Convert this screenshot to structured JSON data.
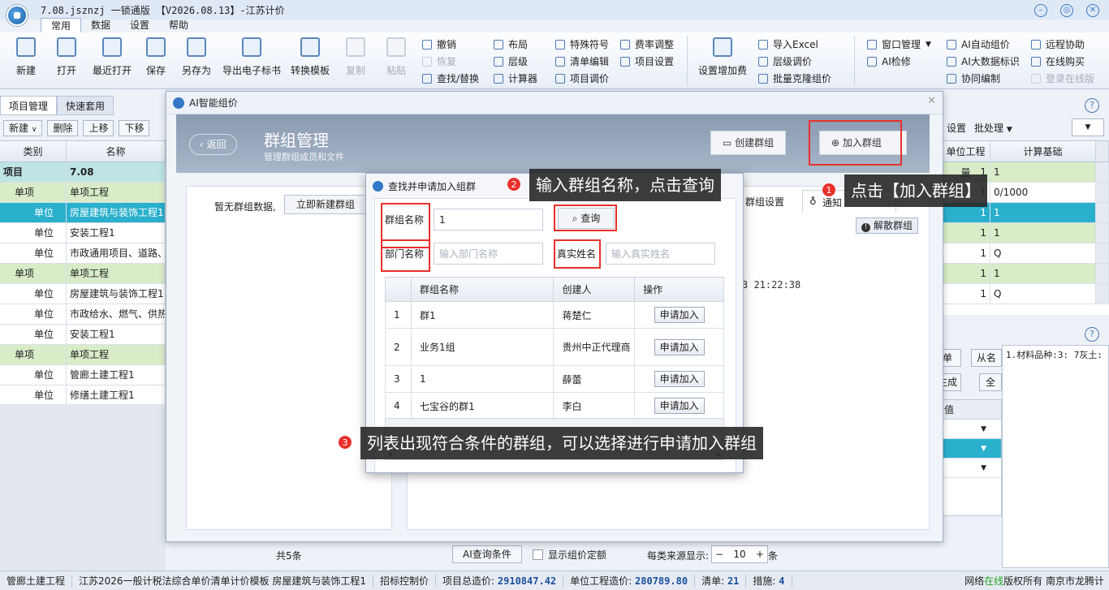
{
  "window": {
    "title": "7.08.jsznzj  一锁通版 【V2026.08.13】-江苏计价",
    "controls": [
      "minimize-icon",
      "settings-icon",
      "close-icon"
    ]
  },
  "menu_tabs": [
    "常用",
    "数据",
    "设置",
    "帮助"
  ],
  "ribbon": {
    "big": [
      "新建",
      "打开",
      "最近打开",
      "保存",
      "另存为",
      "导出电子标书",
      "转换模板",
      "复制",
      "粘贴",
      "设置增加费"
    ],
    "small": {
      "undo": "撤销",
      "redo": "恢复",
      "find": "查找/替换",
      "layout": "布局",
      "level": "层级",
      "calc": "计算器",
      "special": "特殊符号",
      "list_edit": "清单编辑",
      "proj_adjust": "项目调价",
      "rate": "费率调整",
      "proj_set": "项目设置",
      "import_excel": "导入Excel",
      "level_adjust": "层级调价",
      "batch_clone": "批量克隆组价",
      "window_mgr": "窗口管理",
      "ai_check": "AI检修",
      "ai_auto": "AI自动组价",
      "ai_mark": "AI大数据标识",
      "collab": "协同编制",
      "remote": "远程协助",
      "online_buy": "在线购买",
      "online_login": "登录在线版"
    }
  },
  "left_panel": {
    "tabs": [
      "项目管理",
      "快速套用"
    ],
    "toolbar": [
      "新建",
      "删除",
      "上移",
      "下移"
    ],
    "columns": [
      "类别",
      "名称"
    ],
    "rows": [
      {
        "type": "项目",
        "name": "7.08",
        "style": "proj"
      },
      {
        "type": "单项",
        "name": "单项工程",
        "style": "item"
      },
      {
        "type": "单位",
        "name": "房屋建筑与装饰工程1",
        "style": "sel"
      },
      {
        "type": "单位",
        "name": "安装工程1",
        "style": ""
      },
      {
        "type": "单位",
        "name": "市政通用项目、道路、",
        "style": ""
      },
      {
        "type": "单项",
        "name": "单项工程",
        "style": "item"
      },
      {
        "type": "单位",
        "name": "房屋建筑与装饰工程1",
        "style": ""
      },
      {
        "type": "单位",
        "name": "市政给水、燃气、供热",
        "style": ""
      },
      {
        "type": "单位",
        "name": "安装工程1",
        "style": ""
      },
      {
        "type": "单项",
        "name": "单项工程",
        "style": "item"
      },
      {
        "type": "单位",
        "name": "管廊土建工程1",
        "style": ""
      },
      {
        "type": "单位",
        "name": "修缮土建工程1",
        "style": ""
      }
    ]
  },
  "right_panel": {
    "toolbar": [
      "设置",
      "批处理"
    ],
    "columns": [
      "单位工程量",
      "计算基础"
    ],
    "rows": [
      {
        "qty": "1",
        "base": "1",
        "style": "g"
      },
      {
        "qty": "1",
        "base": "0/1000",
        "style": ""
      },
      {
        "qty": "1",
        "base": "1",
        "style": "c"
      },
      {
        "qty": "1",
        "base": "1",
        "style": "g"
      },
      {
        "qty": "1",
        "base": "Q",
        "style": ""
      },
      {
        "qty": "1",
        "base": "1",
        "style": "g"
      },
      {
        "qty": "1",
        "base": "Q",
        "style": ""
      }
    ],
    "lower_text": "1.材料品种:3: 7灰土:",
    "lower_fragments": [
      "单",
      "从名",
      "生成",
      "全",
      "值"
    ]
  },
  "bottom_strip": {
    "total": "共5条",
    "ai_query": "AI查询条件",
    "show_fix": "显示组价定额",
    "per_page_label": "每类来源显示:",
    "per_page_value": "10",
    "per_page_unit": "条"
  },
  "statusbar": {
    "project": "管廊土建工程",
    "template": "江苏2026一般计税法综合单价清单计价模板 房屋建筑与装饰工程1",
    "bid_price": "招标控制价",
    "total_label": "项目总造价:",
    "total_value": "2910847.42",
    "unit_label": "单位工程造价:",
    "unit_value": "280789.80",
    "list_label": "清单:",
    "list_value": "21",
    "measure_label": "措施:",
    "measure_value": "4",
    "network_prefix": "网络",
    "network_online": "在线",
    "network_suffix": "版权所有 南京市龙腾计"
  },
  "ai_dialog": {
    "title": "AI智能组价",
    "back": "返回",
    "heading": "群组管理",
    "subheading": "管理群组成员和文件",
    "create_group": "创建群组",
    "join_group": "加入群组",
    "no_data": "暂无群组数据,",
    "new_group_now": "立即新建群组",
    "group_settings": "群组设置",
    "notify": "通知",
    "dissolve": "解散群组",
    "time": "3 21:22:38"
  },
  "search_dialog": {
    "title": "查找并申请加入组群",
    "group_name_label": "群组名称",
    "group_name_value": "1",
    "query_button": "查询",
    "dept_label": "部门名称",
    "dept_placeholder": "输入部门名称",
    "realname_label": "真实姓名",
    "realname_placeholder": "输入真实姓名",
    "table": {
      "columns": [
        "",
        "群组名称",
        "创建人",
        "操作"
      ],
      "rows": [
        {
          "no": "1",
          "name": "群1",
          "creator": "蒋楚仁",
          "action": "申请加入"
        },
        {
          "no": "2",
          "name": "业务1组",
          "creator": "贵州中正代理商",
          "action": "申请加入"
        },
        {
          "no": "3",
          "name": "1",
          "creator": "薛蕾",
          "action": "申请加入"
        },
        {
          "no": "4",
          "name": "七宝谷的群1",
          "creator": "李白",
          "action": "申请加入"
        }
      ]
    }
  },
  "callouts": {
    "c1": {
      "num": "1",
      "text": "点击【加入群组】"
    },
    "c2": {
      "num": "2",
      "text": "输入群组名称，点击查询"
    },
    "c3": {
      "num": "3",
      "text": "列表出现符合条件的群组，可以选择进行申请加入群组"
    }
  },
  "colors": {
    "accent": "#e8302b",
    "brand": "#1b5fa8",
    "selected_row": "#2ab0cc",
    "group_row": "#d9ecc8"
  }
}
